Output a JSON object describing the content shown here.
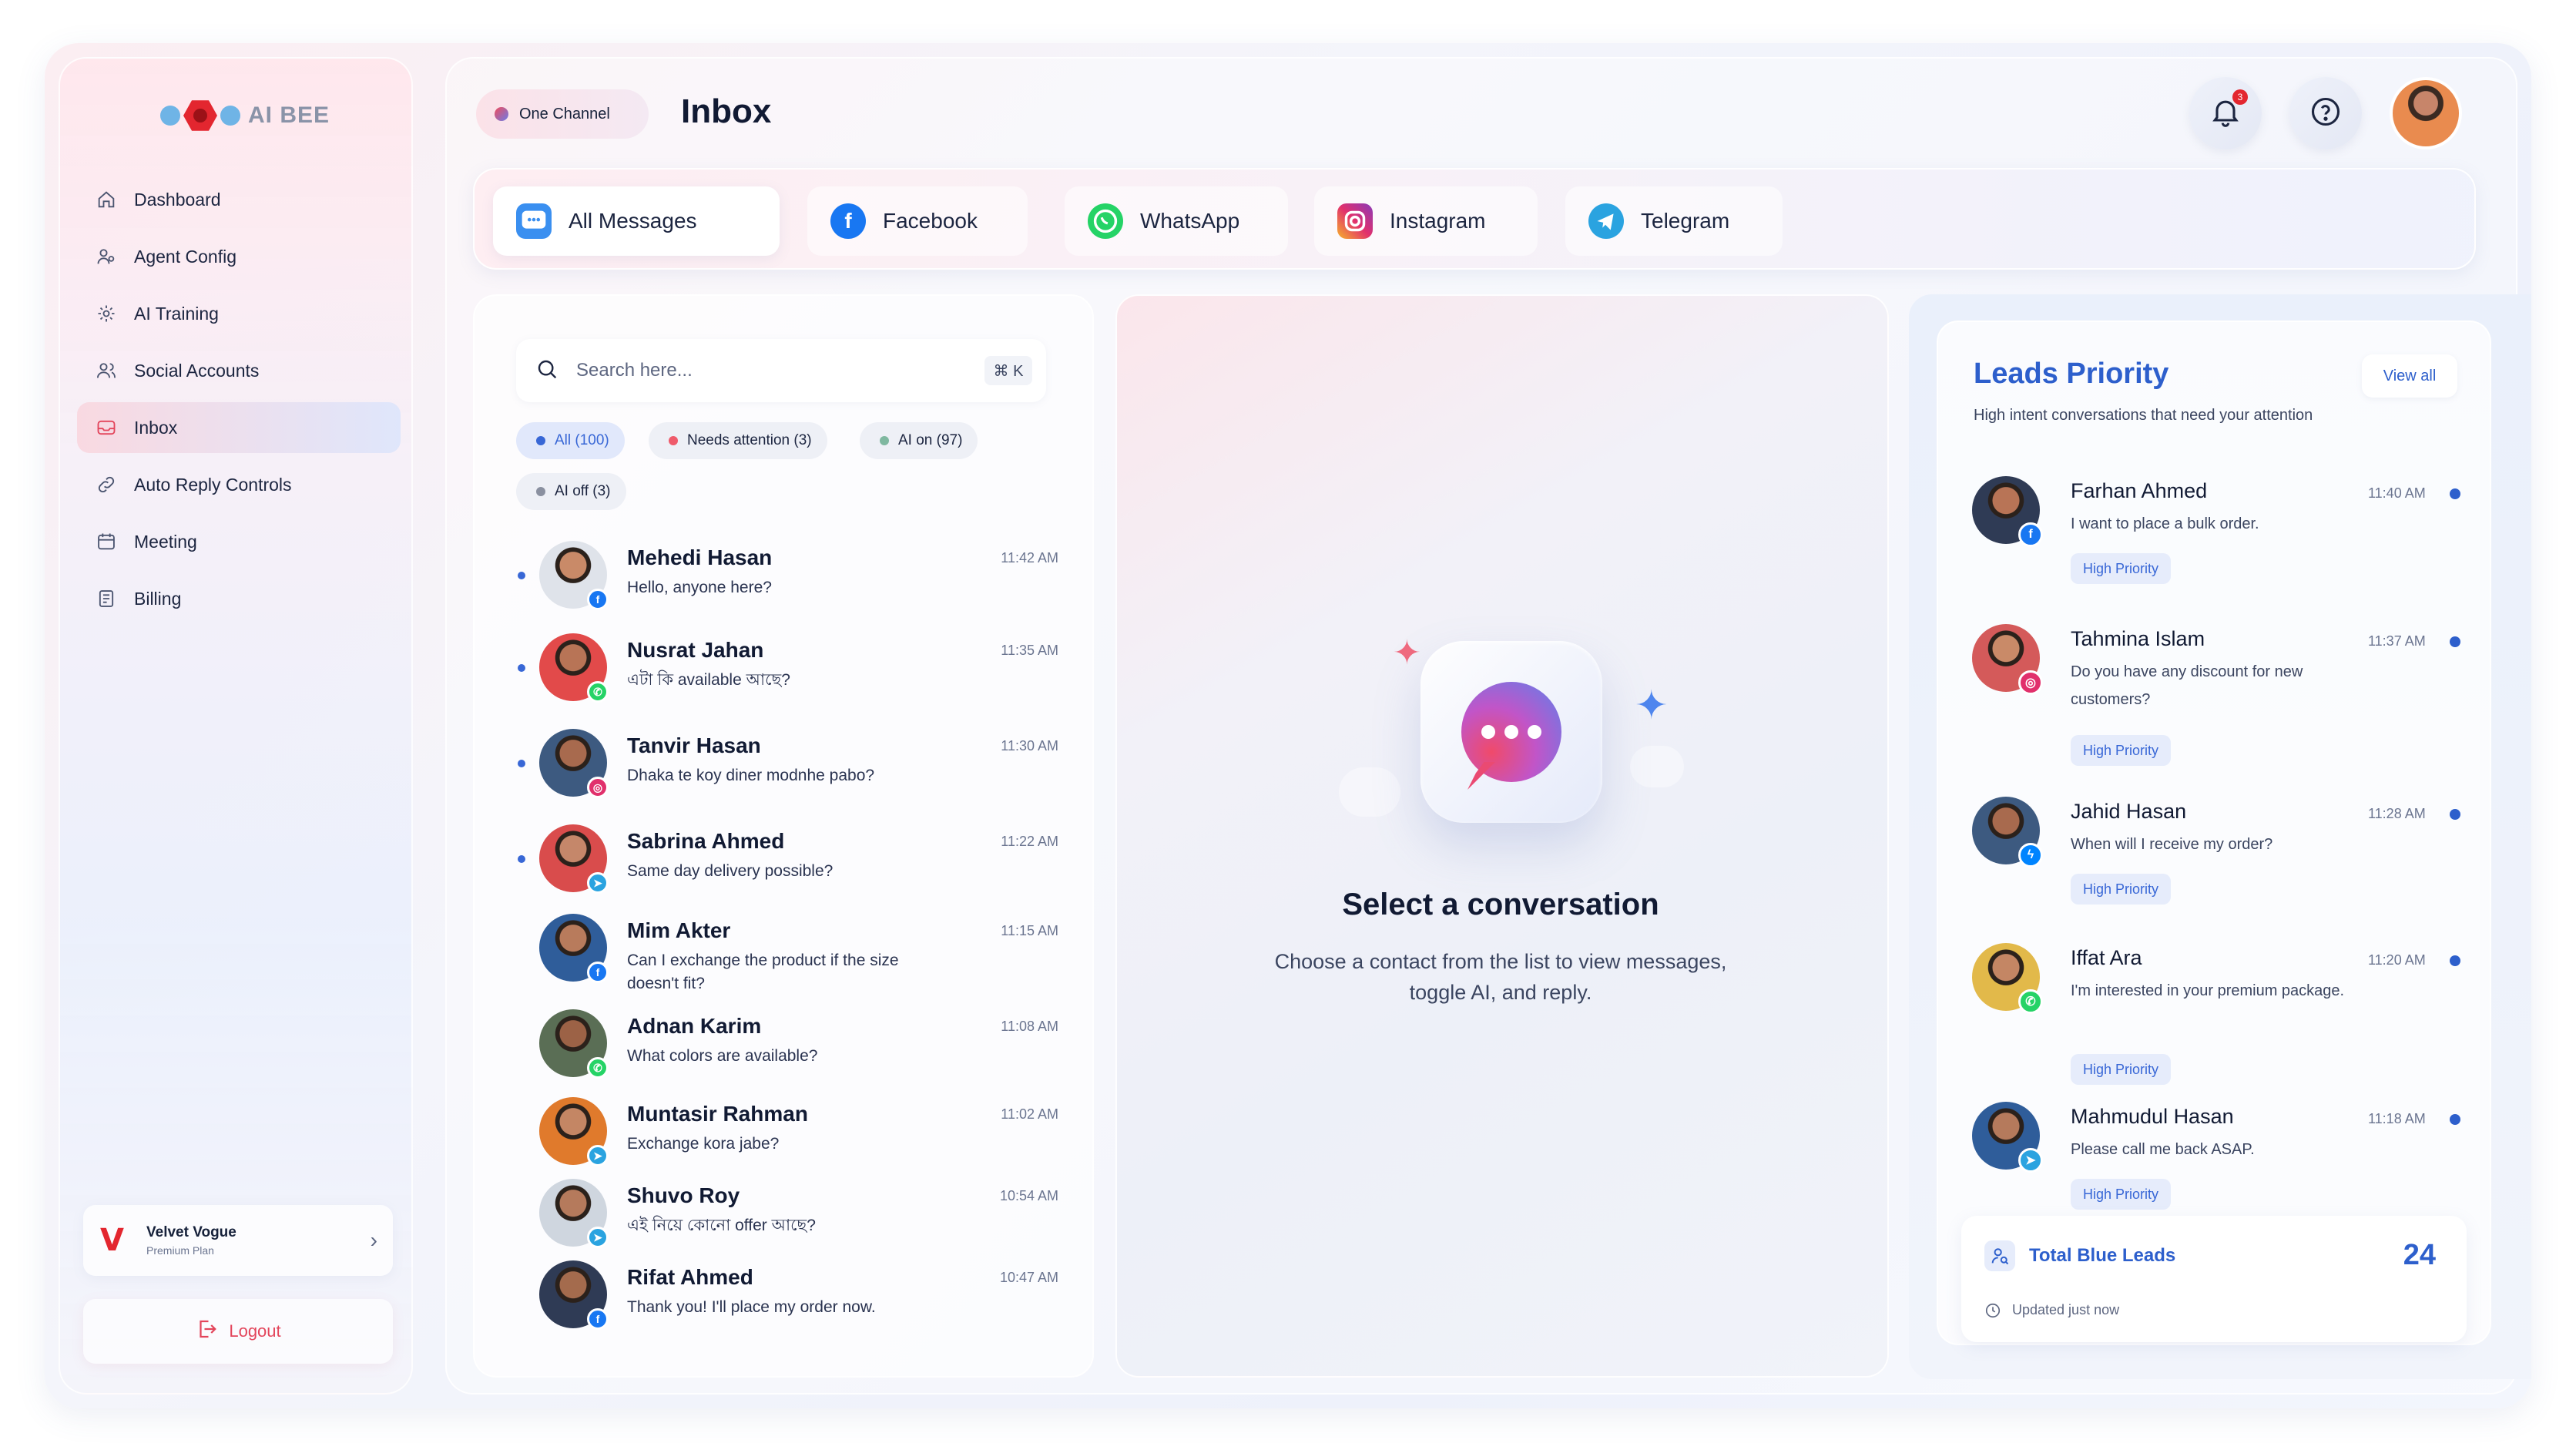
{
  "brand": {
    "name": "AI BEE"
  },
  "sidebar": {
    "items": [
      {
        "label": "Dashboard",
        "icon": "home-icon"
      },
      {
        "label": "Agent Config",
        "icon": "agent-icon"
      },
      {
        "label": "AI Training",
        "icon": "gear-icon"
      },
      {
        "label": "Social Accounts",
        "icon": "users-icon"
      },
      {
        "label": "Inbox",
        "icon": "inbox-icon",
        "active": true
      },
      {
        "label": "Auto Reply Controls",
        "icon": "link-icon"
      },
      {
        "label": "Meeting",
        "icon": "calendar-icon"
      },
      {
        "label": "Billing",
        "icon": "receipt-icon"
      }
    ],
    "profile": {
      "logo": "V",
      "name": "Velvet Vogue",
      "plan": "Premium Plan"
    },
    "logout_label": "Logout"
  },
  "header": {
    "channel_label": "One Channel",
    "title": "Inbox",
    "notification_count": "3"
  },
  "tabs": [
    {
      "label": "All Messages",
      "icon": "chat-icon",
      "active": true
    },
    {
      "label": "Facebook",
      "icon": "facebook-icon"
    },
    {
      "label": "WhatsApp",
      "icon": "whatsapp-icon"
    },
    {
      "label": "Instagram",
      "icon": "instagram-icon"
    },
    {
      "label": "Telegram",
      "icon": "telegram-icon"
    }
  ],
  "search": {
    "placeholder": "Search here...",
    "shortcut": "⌘ K"
  },
  "filters": [
    {
      "label": "All (100)",
      "color": "#3867d6",
      "active": true
    },
    {
      "label": "Needs attention (3)",
      "color": "#ef5b6b"
    },
    {
      "label": "AI on (97)",
      "color": "#7fb8a0"
    },
    {
      "label": "AI off (3)",
      "color": "#8a90a0"
    }
  ],
  "conversations": [
    {
      "name": "Mehedi Hasan",
      "message": "Hello, anyone here?",
      "time": "11:42 AM",
      "unread": true,
      "channel": "facebook"
    },
    {
      "name": "Nusrat Jahan",
      "message": "এটা কি available আছে?",
      "time": "11:35 AM",
      "unread": true,
      "channel": "whatsapp"
    },
    {
      "name": "Tanvir Hasan",
      "message": "Dhaka te koy diner modnhe pabo?",
      "time": "11:30 AM",
      "unread": true,
      "channel": "instagram"
    },
    {
      "name": "Sabrina Ahmed",
      "message": "Same day delivery possible?",
      "time": "11:22 AM",
      "unread": true,
      "channel": "telegram"
    },
    {
      "name": "Mim Akter",
      "message": "Can I exchange the product if the size doesn't fit?",
      "time": "11:15 AM",
      "unread": false,
      "channel": "facebook"
    },
    {
      "name": "Adnan Karim",
      "message": "What colors are available?",
      "time": "11:08 AM",
      "unread": false,
      "channel": "whatsapp"
    },
    {
      "name": "Muntasir Rahman",
      "message": "Exchange kora jabe?",
      "time": "11:02 AM",
      "unread": false,
      "channel": "telegram"
    },
    {
      "name": "Shuvo Roy",
      "message": "এই নিয়ে কোনো offer আছে?",
      "time": "10:54 AM",
      "unread": false,
      "channel": "telegram"
    },
    {
      "name": "Rifat Ahmed",
      "message": "Thank you! I'll place my order now.",
      "time": "10:47 AM",
      "unread": false,
      "channel": "facebook"
    }
  ],
  "empty_state": {
    "title": "Select a conversation",
    "description": "Choose a contact from the list to view messages, toggle AI, and reply."
  },
  "leads": {
    "title": "Leads Priority",
    "view_all": "View all",
    "subtitle": "High intent conversations that need your attention",
    "items": [
      {
        "name": "Farhan Ahmed",
        "message": "I want to place a bulk order.",
        "time": "11:40 AM",
        "badge": "High Priority",
        "channel": "facebook"
      },
      {
        "name": "Tahmina Islam",
        "message": "Do you have any discount for new customers?",
        "time": "11:37 AM",
        "badge": "High Priority",
        "channel": "instagram"
      },
      {
        "name": "Jahid Hasan",
        "message": "When will I receive my order?",
        "time": "11:28 AM",
        "badge": "High Priority",
        "channel": "messenger"
      },
      {
        "name": "Iffat Ara",
        "message": "I'm interested in your premium package.",
        "time": "11:20 AM",
        "badge": "High Priority",
        "channel": "whatsapp"
      },
      {
        "name": "Mahmudul Hasan",
        "message": "Please call me back ASAP.",
        "time": "11:18 AM",
        "badge": "High Priority",
        "channel": "telegram"
      }
    ],
    "total_label": "Total Blue Leads",
    "total_value": "24",
    "updated": "Updated just now"
  },
  "colors": {
    "accent": "#2d5fcc",
    "brand_red": "#e3262f",
    "facebook": "#1877f2",
    "whatsapp": "#25d366",
    "instagram": "#e1306c",
    "telegram": "#2aa3e0"
  }
}
